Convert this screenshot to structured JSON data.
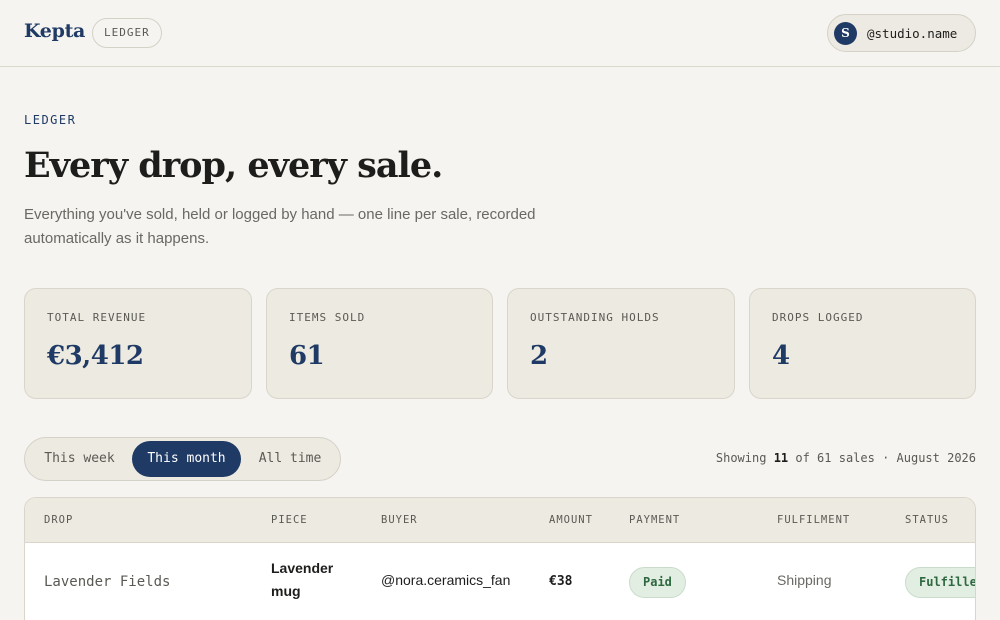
{
  "header": {
    "brand": "Kepta",
    "section_pill": "LEDGER",
    "user": {
      "initial": "S",
      "handle": "@studio.name"
    }
  },
  "page": {
    "eyebrow": "LEDGER",
    "title": "Every drop, every sale.",
    "subtitle": "Everything you've sold, held or logged by hand — one line per sale, recorded automatically as it happens."
  },
  "stats": [
    {
      "label": "TOTAL REVENUE",
      "value": "€3,412"
    },
    {
      "label": "ITEMS SOLD",
      "value": "61"
    },
    {
      "label": "OUTSTANDING HOLDS",
      "value": "2"
    },
    {
      "label": "DROPS LOGGED",
      "value": "4"
    }
  ],
  "filters": {
    "options": [
      "This week",
      "This month",
      "All time"
    ],
    "selected": "This month"
  },
  "summary": {
    "prefix": "Showing",
    "shown": "11",
    "middle": "of 61 sales · August 2026"
  },
  "table": {
    "columns": [
      "DROP",
      "PIECE",
      "BUYER",
      "AMOUNT",
      "PAYMENT",
      "FULFILMENT",
      "STATUS"
    ],
    "rows": [
      {
        "drop": "Lavender Fields",
        "piece": "Lavender mug",
        "buyer": "@nora.ceramics_fan",
        "amount": "€38",
        "payment": "Paid",
        "fulfilment": "Shipping",
        "status": "Fulfilled"
      }
    ]
  },
  "colors": {
    "background": "#f5f4f0",
    "accent": "#1f3a64",
    "card": "#edeae1",
    "badge_bg": "#e3eee2",
    "badge_text": "#2e6840"
  }
}
